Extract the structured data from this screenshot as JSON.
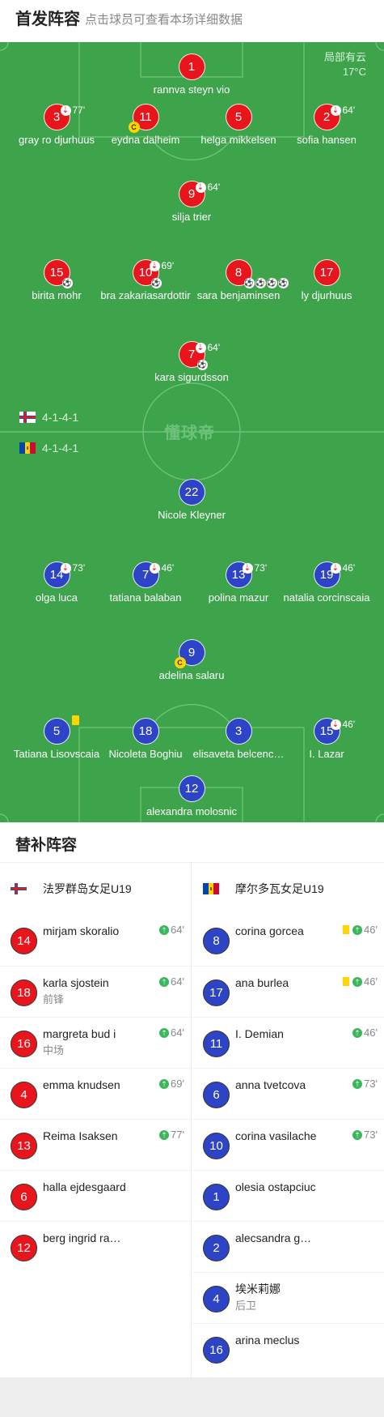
{
  "header": {
    "title": "首发阵容",
    "hint": "点击球员可查看本场详细数据"
  },
  "weather": {
    "desc": "局部有云",
    "temp": "17°C"
  },
  "watermark": "懂球帝",
  "home": {
    "formation": "4-1-4-1",
    "players": [
      {
        "number": "1",
        "name": "rannva steyn vio"
      },
      {
        "number": "3",
        "name": "gray ro djurhuus",
        "sub_minute": "77'"
      },
      {
        "number": "11",
        "name": "eydna dalheim",
        "captain": "C"
      },
      {
        "number": "5",
        "name": "helga mikkelsen"
      },
      {
        "number": "2",
        "name": "sofia hansen",
        "sub_minute": "64'"
      },
      {
        "number": "9",
        "name": "silja trier",
        "sub_minute": "64'"
      },
      {
        "number": "15",
        "name": "birita mohr",
        "goals": [
          "⚽"
        ]
      },
      {
        "number": "10",
        "name": "bra zakariasardottir",
        "sub_minute": "69'",
        "goals": [
          "⚽"
        ]
      },
      {
        "number": "8",
        "name": "sara benjaminsen",
        "goals": [
          "⚽",
          "⚽",
          "⚽",
          "⚽"
        ]
      },
      {
        "number": "17",
        "name": "ly djurhuus"
      },
      {
        "number": "7",
        "name": "kara sigurdsson",
        "sub_minute": "64'",
        "goals": [
          "⚽"
        ]
      }
    ]
  },
  "away": {
    "formation": "4-1-4-1",
    "players": [
      {
        "number": "22",
        "name": "Nicole Kleyner"
      },
      {
        "number": "14",
        "name": "olga luca",
        "sub_minute": "73'"
      },
      {
        "number": "7",
        "name": "tatiana balaban",
        "sub_minute": "46'"
      },
      {
        "number": "13",
        "name": "polina mazur",
        "sub_minute": "73'"
      },
      {
        "number": "19",
        "name": "natalia corcinscaia",
        "sub_minute": "46'"
      },
      {
        "number": "9",
        "name": "adelina salaru",
        "captain": "C"
      },
      {
        "number": "5",
        "name": "Tatiana Lisovscaia"
      },
      {
        "number": "18",
        "name": "Nicoleta Boghiu"
      },
      {
        "number": "3",
        "name": "elisaveta belcenc…"
      },
      {
        "number": "15",
        "name": "I. Lazar",
        "sub_minute": "46'"
      },
      {
        "number": "12",
        "name": "alexandra molosnic"
      }
    ]
  },
  "subs": {
    "title": "替补阵容",
    "home_team": "法罗群岛女足U19",
    "away_team": "摩尔多瓦女足U19",
    "home": [
      {
        "number": "14",
        "name": "mirjam skoralio",
        "minute": "64'"
      },
      {
        "number": "18",
        "name": "karla sjostein",
        "position": "前锋",
        "minute": "64'"
      },
      {
        "number": "16",
        "name": "margreta bud i",
        "position": "中场",
        "minute": "64'"
      },
      {
        "number": "4",
        "name": "emma knudsen",
        "minute": "69'"
      },
      {
        "number": "13",
        "name": "Reima Isaksen",
        "minute": "77'"
      },
      {
        "number": "6",
        "name": "halla ejdesgaard"
      },
      {
        "number": "12",
        "name": "berg ingrid ra…"
      }
    ],
    "away": [
      {
        "number": "8",
        "name": "corina gorcea",
        "minute": "46'",
        "card": "yellow"
      },
      {
        "number": "17",
        "name": "ana burlea",
        "minute": "46'",
        "card": "yellow"
      },
      {
        "number": "11",
        "name": "I. Demian",
        "minute": "46'"
      },
      {
        "number": "6",
        "name": "anna tvetcova",
        "minute": "73'"
      },
      {
        "number": "10",
        "name": "corina vasilache",
        "minute": "73'"
      },
      {
        "number": "1",
        "name": "olesia ostapciuc"
      },
      {
        "number": "2",
        "name": "alecsandra g…"
      },
      {
        "number": "4",
        "name": "埃米莉娜",
        "position": "后卫"
      },
      {
        "number": "16",
        "name": "arina meclus"
      }
    ]
  }
}
